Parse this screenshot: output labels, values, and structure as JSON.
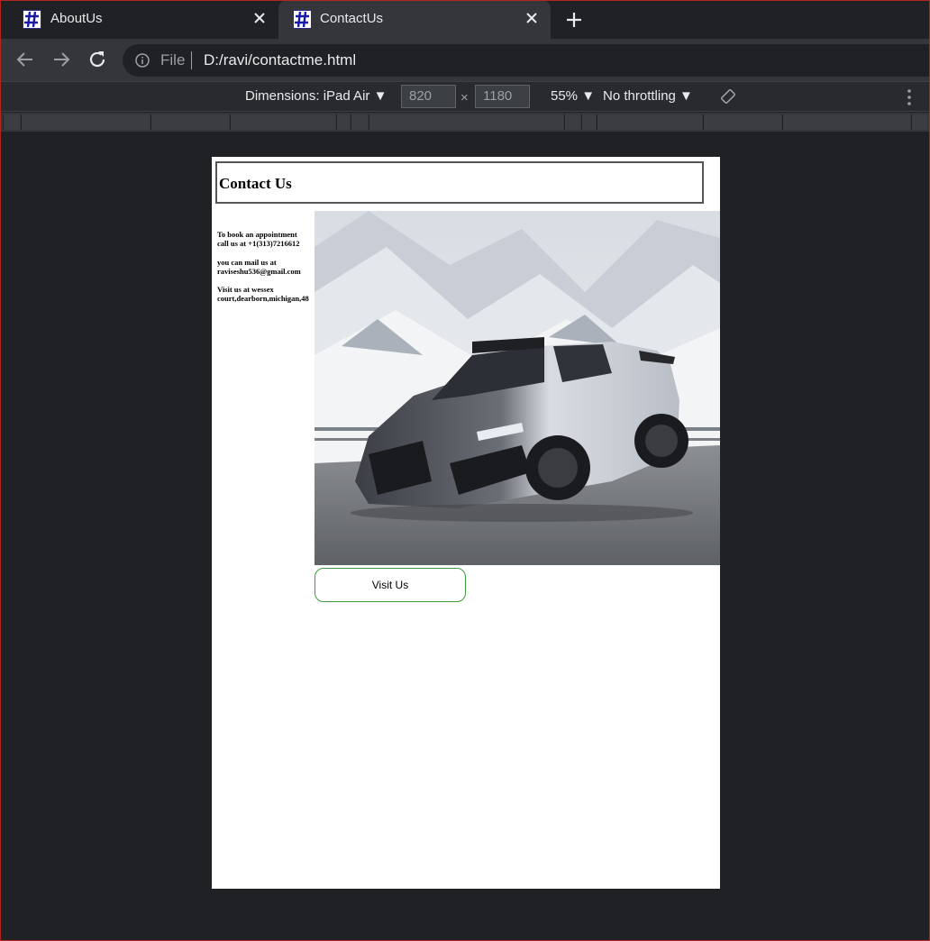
{
  "browser": {
    "tabs": [
      {
        "title": "AboutUs",
        "active": false
      },
      {
        "title": "ContactUs",
        "active": true
      }
    ],
    "address": {
      "scheme": "File",
      "url": "D:/ravi/contactme.html"
    }
  },
  "devtools": {
    "dimensions_label": "Dimensions: iPad Air",
    "width": "820",
    "times": "×",
    "height": "1180",
    "zoom": "55%",
    "throttling": "No throttling"
  },
  "page": {
    "heading": "Contact Us",
    "contact_lines": [
      "To book an appointment\ncall us at +1(313)7216612",
      "you can mail us at\nraviseshu536@gmail.com",
      "Visit us at wessex\ncourt,dearborn,michigan,48"
    ],
    "image_description": "silver sports car on snowy mountain road",
    "visit_button": "Visit Us"
  },
  "colors": {
    "browser_bg": "#202124",
    "toolbar_bg": "#35363a",
    "button_border": "#3f9a3f"
  }
}
